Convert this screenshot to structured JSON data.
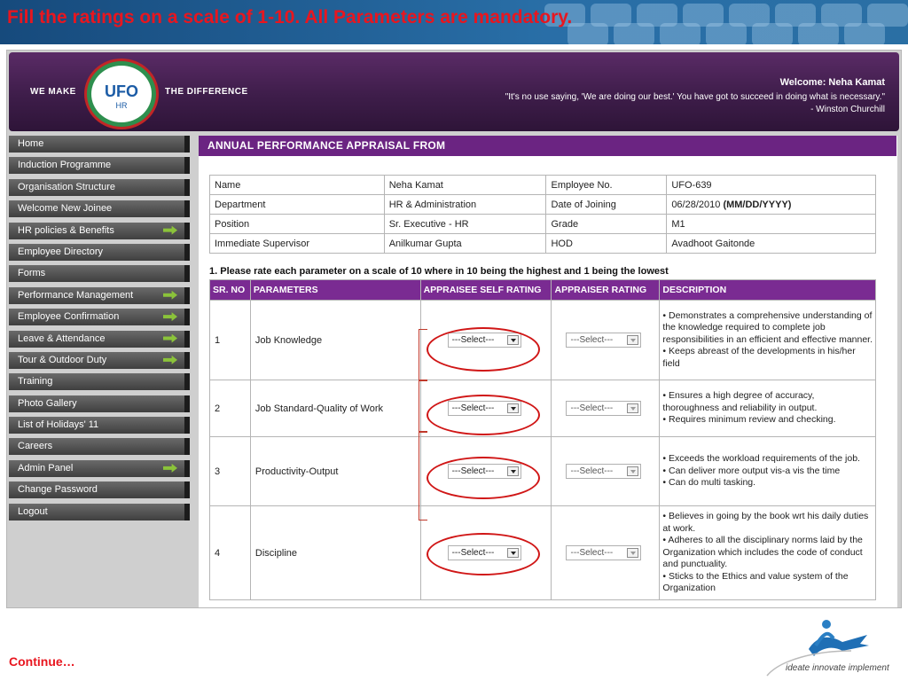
{
  "slide": {
    "title": "Fill the ratings on a scale of 1-10. All Parameters are mandatory.",
    "continue": "Continue…",
    "tagline": "ideate innovate implement"
  },
  "header": {
    "left_text": "WE MAKE",
    "right_text": "THE DIFFERENCE",
    "logo_main": "UFO",
    "logo_sub": "HR",
    "welcome": "Welcome: Neha Kamat",
    "quote": "\"It's no use saying, 'We are doing our best.' You have got to succeed in doing what is necessary.\" - Winston Churchill"
  },
  "sidebar": {
    "items": [
      {
        "label": "Home",
        "has_arrow": false
      },
      {
        "label": "Induction Programme",
        "has_arrow": false
      },
      {
        "label": "Organisation Structure",
        "has_arrow": false
      },
      {
        "label": "Welcome New Joinee",
        "has_arrow": false
      },
      {
        "label": "HR policies & Benefits",
        "has_arrow": true
      },
      {
        "label": "Employee Directory",
        "has_arrow": false
      },
      {
        "label": "Forms",
        "has_arrow": false
      },
      {
        "label": "Performance Management",
        "has_arrow": true
      },
      {
        "label": "Employee Confirmation",
        "has_arrow": true
      },
      {
        "label": "Leave & Attendance",
        "has_arrow": true
      },
      {
        "label": "Tour & Outdoor Duty",
        "has_arrow": true
      },
      {
        "label": "Training",
        "has_arrow": false
      },
      {
        "label": "Photo Gallery",
        "has_arrow": false
      },
      {
        "label": "List of Holidays' 11",
        "has_arrow": false
      },
      {
        "label": "Careers",
        "has_arrow": false
      },
      {
        "label": "Admin Panel",
        "has_arrow": true
      },
      {
        "label": "Change Password",
        "has_arrow": false
      },
      {
        "label": "Logout",
        "has_arrow": false
      }
    ]
  },
  "form": {
    "title": "ANNUAL PERFORMANCE APPRAISAL FROM",
    "info_rows": [
      [
        "Name",
        "Neha Kamat",
        "Employee No.",
        "UFO-639"
      ],
      [
        "Department",
        "HR & Administration",
        "Date of Joining",
        "06/28/2010 "
      ],
      [
        "Position",
        "Sr. Executive - HR",
        "Grade",
        "M1"
      ],
      [
        "Immediate Supervisor",
        "Anilkumar Gupta",
        "HOD",
        "Avadhoot Gaitonde"
      ]
    ],
    "date_format": "(MM/DD/YYYY)",
    "instruction": "1. Please rate each parameter on a scale of 10 where in 10 being the highest and 1 being the lowest",
    "columns": [
      "SR. NO",
      "PARAMETERS",
      "APPRAISEE SELF RATING",
      "APPRAISER RATING",
      "DESCRIPTION"
    ],
    "select_label": "---Select---",
    "rows": [
      {
        "no": "1",
        "param": "Job Knowledge",
        "desc": "• Demonstrates a comprehensive understanding of the knowledge required to complete job responsibilities in an efficient and effective manner.\n• Keeps abreast of the developments in his/her field"
      },
      {
        "no": "2",
        "param": "Job Standard-Quality of Work",
        "desc": "• Ensures a high degree of accuracy, thoroughness and reliability in output.\n• Requires minimum review and checking."
      },
      {
        "no": "3",
        "param": "Productivity-Output",
        "desc": "• Exceeds the workload requirements of the job.\n• Can deliver more output vis-a vis the time\n• Can do multi tasking."
      },
      {
        "no": "4",
        "param": "Discipline",
        "desc": "• Believes in going by the book wrt his daily duties at work.\n• Adheres to all the disciplinary norms laid by the Organization which includes the code of conduct and punctuality.\n• Sticks to the Ethics and value system of the Organization"
      }
    ]
  }
}
